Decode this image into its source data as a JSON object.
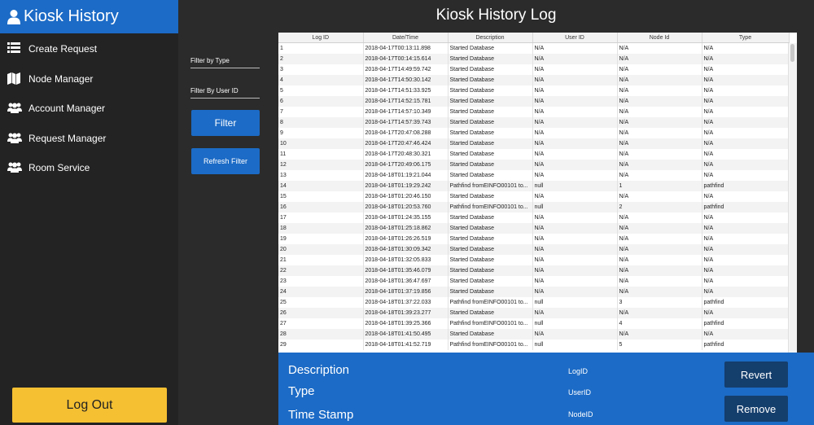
{
  "app": {
    "title": "Kiosk History",
    "accent_color": "#1c6bc6",
    "logout_color": "#f5c032",
    "user_icon": "user-icon"
  },
  "sidebar": {
    "items": [
      {
        "label": "Create Request",
        "icon": "list-icon"
      },
      {
        "label": "Node Manager",
        "icon": "map-icon"
      },
      {
        "label": "Account Manager",
        "icon": "users-icon"
      },
      {
        "label": "Request Manager",
        "icon": "users-icon"
      },
      {
        "label": "Room Service",
        "icon": "users-icon"
      }
    ],
    "logout_label": "Log Out"
  },
  "main": {
    "title": "Kiosk History Log"
  },
  "filters": {
    "type_label": "Filter by Type",
    "user_label": "Filter By User ID",
    "filter_button": "Filter",
    "refresh_button": "Refresh Filter"
  },
  "table": {
    "columns": [
      "Log ID",
      "Date/Time",
      "Description",
      "User ID",
      "Node Id",
      "Type"
    ],
    "rows": [
      [
        "1",
        "2018-04-17T00:13:11.898",
        "Started Database",
        "N/A",
        "N/A",
        "N/A"
      ],
      [
        "2",
        "2018-04-17T00:14:15.614",
        "Started Database",
        "N/A",
        "N/A",
        "N/A"
      ],
      [
        "3",
        "2018-04-17T14:49:59.742",
        "Started Database",
        "N/A",
        "N/A",
        "N/A"
      ],
      [
        "4",
        "2018-04-17T14:50:30.142",
        "Started Database",
        "N/A",
        "N/A",
        "N/A"
      ],
      [
        "5",
        "2018-04-17T14:51:33.925",
        "Started Database",
        "N/A",
        "N/A",
        "N/A"
      ],
      [
        "6",
        "2018-04-17T14:52:15.781",
        "Started Database",
        "N/A",
        "N/A",
        "N/A"
      ],
      [
        "7",
        "2018-04-17T14:57:10.349",
        "Started Database",
        "N/A",
        "N/A",
        "N/A"
      ],
      [
        "8",
        "2018-04-17T14:57:39.743",
        "Started Database",
        "N/A",
        "N/A",
        "N/A"
      ],
      [
        "9",
        "2018-04-17T20:47:08.288",
        "Started Database",
        "N/A",
        "N/A",
        "N/A"
      ],
      [
        "10",
        "2018-04-17T20:47:46.424",
        "Started Database",
        "N/A",
        "N/A",
        "N/A"
      ],
      [
        "11",
        "2018-04-17T20:48:30.321",
        "Started Database",
        "N/A",
        "N/A",
        "N/A"
      ],
      [
        "12",
        "2018-04-17T20:49:06.175",
        "Started Database",
        "N/A",
        "N/A",
        "N/A"
      ],
      [
        "13",
        "2018-04-18T01:19:21.044",
        "Started Database",
        "N/A",
        "N/A",
        "N/A"
      ],
      [
        "14",
        "2018-04-18T01:19:29.242",
        "Pathfind fromEINFO00101 to...",
        "null",
        "1",
        "pathfind"
      ],
      [
        "15",
        "2018-04-18T01:20:46.150",
        "Started Database",
        "N/A",
        "N/A",
        "N/A"
      ],
      [
        "16",
        "2018-04-18T01:20:53.760",
        "Pathfind fromEINFO00101 to...",
        "null",
        "2",
        "pathfind"
      ],
      [
        "17",
        "2018-04-18T01:24:35.155",
        "Started Database",
        "N/A",
        "N/A",
        "N/A"
      ],
      [
        "18",
        "2018-04-18T01:25:18.862",
        "Started Database",
        "N/A",
        "N/A",
        "N/A"
      ],
      [
        "19",
        "2018-04-18T01:26:26.519",
        "Started Database",
        "N/A",
        "N/A",
        "N/A"
      ],
      [
        "20",
        "2018-04-18T01:30:09.342",
        "Started Database",
        "N/A",
        "N/A",
        "N/A"
      ],
      [
        "21",
        "2018-04-18T01:32:05.833",
        "Started Database",
        "N/A",
        "N/A",
        "N/A"
      ],
      [
        "22",
        "2018-04-18T01:35:46.079",
        "Started Database",
        "N/A",
        "N/A",
        "N/A"
      ],
      [
        "23",
        "2018-04-18T01:36:47.697",
        "Started Database",
        "N/A",
        "N/A",
        "N/A"
      ],
      [
        "24",
        "2018-04-18T01:37:19.856",
        "Started Database",
        "N/A",
        "N/A",
        "N/A"
      ],
      [
        "25",
        "2018-04-18T01:37:22.033",
        "Pathfind fromEINFO00101 to...",
        "null",
        "3",
        "pathfind"
      ],
      [
        "26",
        "2018-04-18T01:39:23.277",
        "Started Database",
        "N/A",
        "N/A",
        "N/A"
      ],
      [
        "27",
        "2018-04-18T01:39:25.366",
        "Pathfind fromEINFO00101 to...",
        "null",
        "4",
        "pathfind"
      ],
      [
        "28",
        "2018-04-18T01:41:50.495",
        "Started Database",
        "N/A",
        "N/A",
        "N/A"
      ],
      [
        "29",
        "2018-04-18T01:41:52.719",
        "Pathfind fromEINFO00101 to...",
        "null",
        "5",
        "pathfind"
      ]
    ]
  },
  "details": {
    "description_label": "Description",
    "type_label": "Type",
    "timestamp_label": "Time Stamp",
    "log_id_label": "LogID",
    "user_id_label": "UserID",
    "node_id_label": "NodeID",
    "revert_button": "Revert",
    "remove_button": "Remove"
  }
}
